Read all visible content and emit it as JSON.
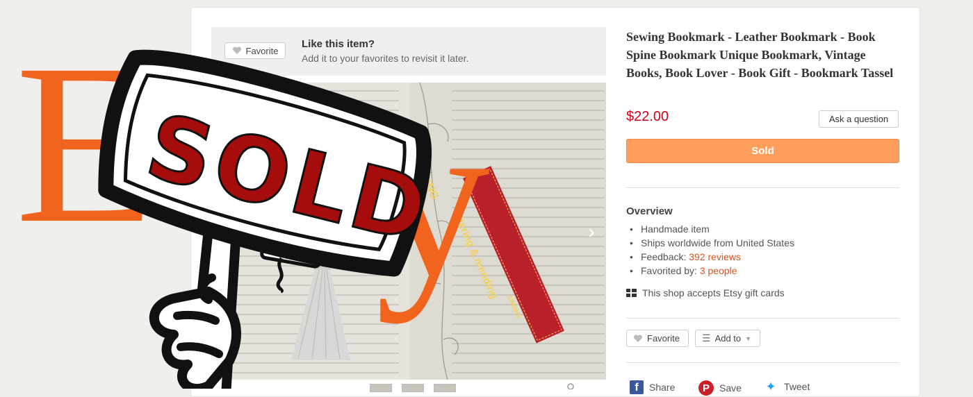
{
  "favorite_bar": {
    "button_label": "Favorite",
    "title": "Like this item?",
    "subtitle": "Add it to your favorites to revisit it later."
  },
  "listing": {
    "title": "Sewing Bookmark - Leather Bookmark - Book Spine Bookmark Unique Bookmark, Vintage Books, Book Lover - Book Gift - Bookmark Tassel",
    "price": "$22.00",
    "ask_button": "Ask a question",
    "sold_button": "Sold"
  },
  "overview": {
    "heading": "Overview",
    "items": [
      {
        "text": "Handmade item"
      },
      {
        "text": "Ships worldwide from United States"
      },
      {
        "text": "Feedback: ",
        "link": "392 reviews"
      },
      {
        "text": "Favorited by: ",
        "link": "3 people"
      }
    ],
    "gift_cards": "This shop accepts Etsy gift cards"
  },
  "actions": {
    "favorite_label": "Favorite",
    "add_to_label": "Add to"
  },
  "social": {
    "share": "Share",
    "save": "Save",
    "tweet": "Tweet"
  },
  "sticker": {
    "logo_text": "Etsy",
    "sign_text": "SOLD"
  },
  "bookmark": {
    "strap_text_1": "ING",
    "strap_text_2": "altering & mending",
    "strap_text_3": "SIMONS",
    "tag_text": "SOLD"
  },
  "colors": {
    "accent": "#d9541e",
    "price": "#d0011b",
    "sold_button": "#ff9e5a",
    "etsy_orange": "#f1641e",
    "sign_red": "#a50d0d"
  }
}
